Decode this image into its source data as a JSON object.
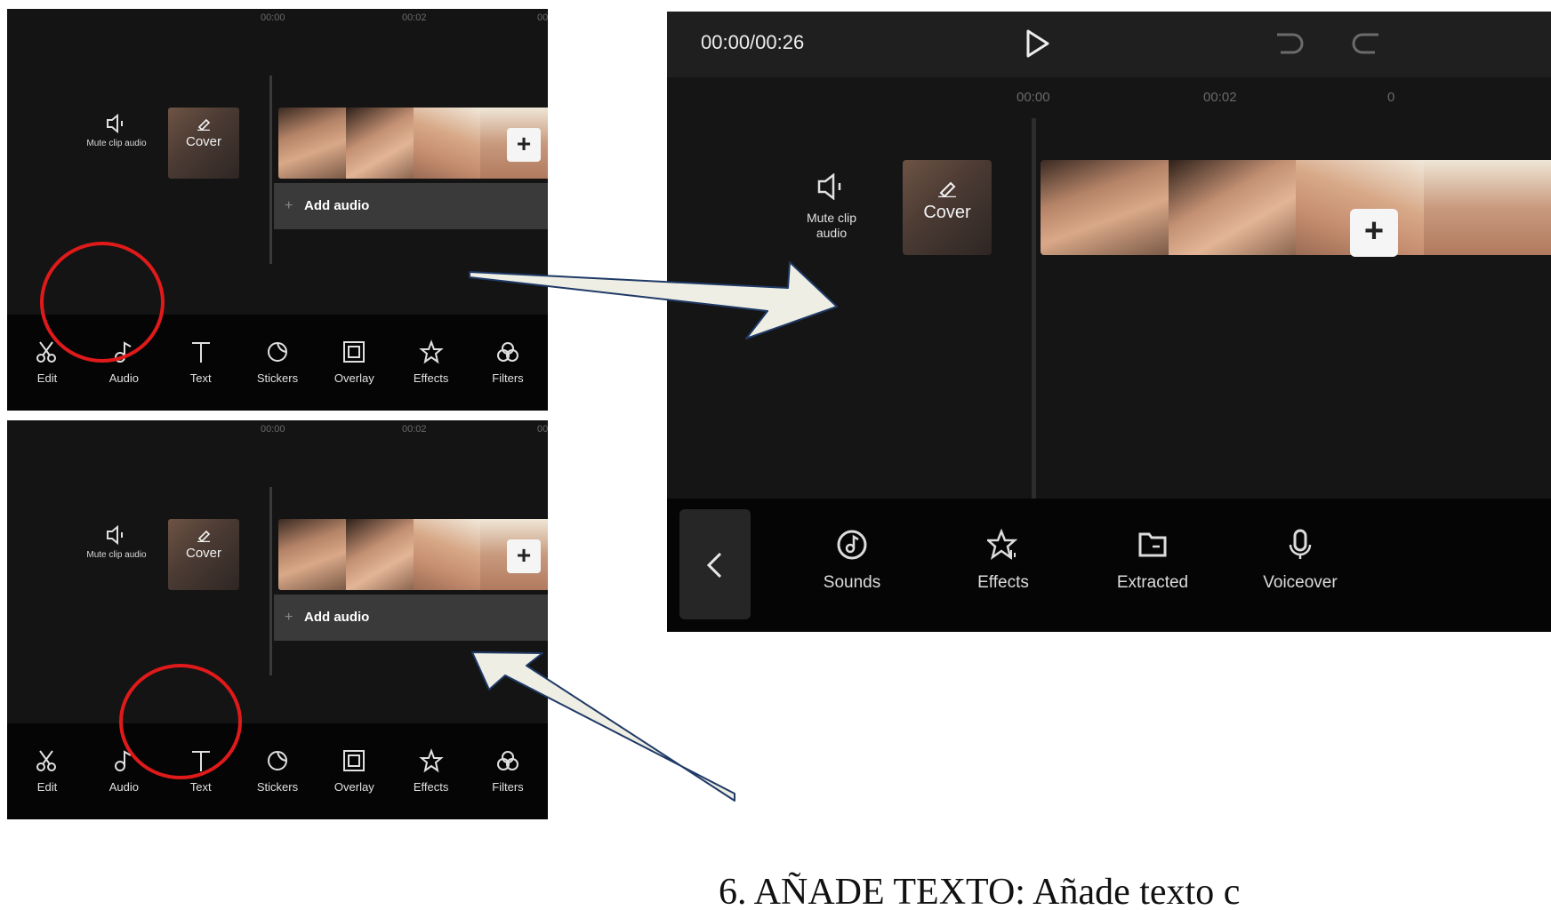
{
  "small_editor": {
    "ruler": [
      "00:00",
      "00:02",
      "00"
    ],
    "mute_label": "Mute clip audio",
    "cover_label": "Cover",
    "add_audio_label": "Add audio",
    "add_clip_icon": "plus-icon",
    "toolbar": [
      {
        "label": "Edit",
        "icon": "scissors-icon"
      },
      {
        "label": "Audio",
        "icon": "music-note-icon"
      },
      {
        "label": "Text",
        "icon": "text-icon"
      },
      {
        "label": "Stickers",
        "icon": "sticker-icon"
      },
      {
        "label": "Overlay",
        "icon": "overlay-icon"
      },
      {
        "label": "Effects",
        "icon": "effects-star-icon"
      },
      {
        "label": "Filters",
        "icon": "filters-icon"
      }
    ]
  },
  "big_editor": {
    "time": "00:00/00:26",
    "ruler": [
      "00:00",
      "00:02",
      "0"
    ],
    "mute_label": "Mute clip audio",
    "cover_label": "Cover",
    "audio_menu": [
      {
        "label": "Sounds",
        "icon": "sounds-icon"
      },
      {
        "label": "Effects",
        "icon": "sound-effects-icon"
      },
      {
        "label": "Extracted",
        "icon": "folder-icon"
      },
      {
        "label": "Voiceover",
        "icon": "microphone-icon"
      }
    ]
  },
  "caption": "6. AÑADE TEXTO: Añade texto c",
  "colors": {
    "app_bg": "#141414",
    "toolbar_bg": "#050505",
    "highlight_circle": "#e01a1a",
    "arrow_fill": "#efeee4",
    "arrow_stroke": "#1f3a66"
  }
}
